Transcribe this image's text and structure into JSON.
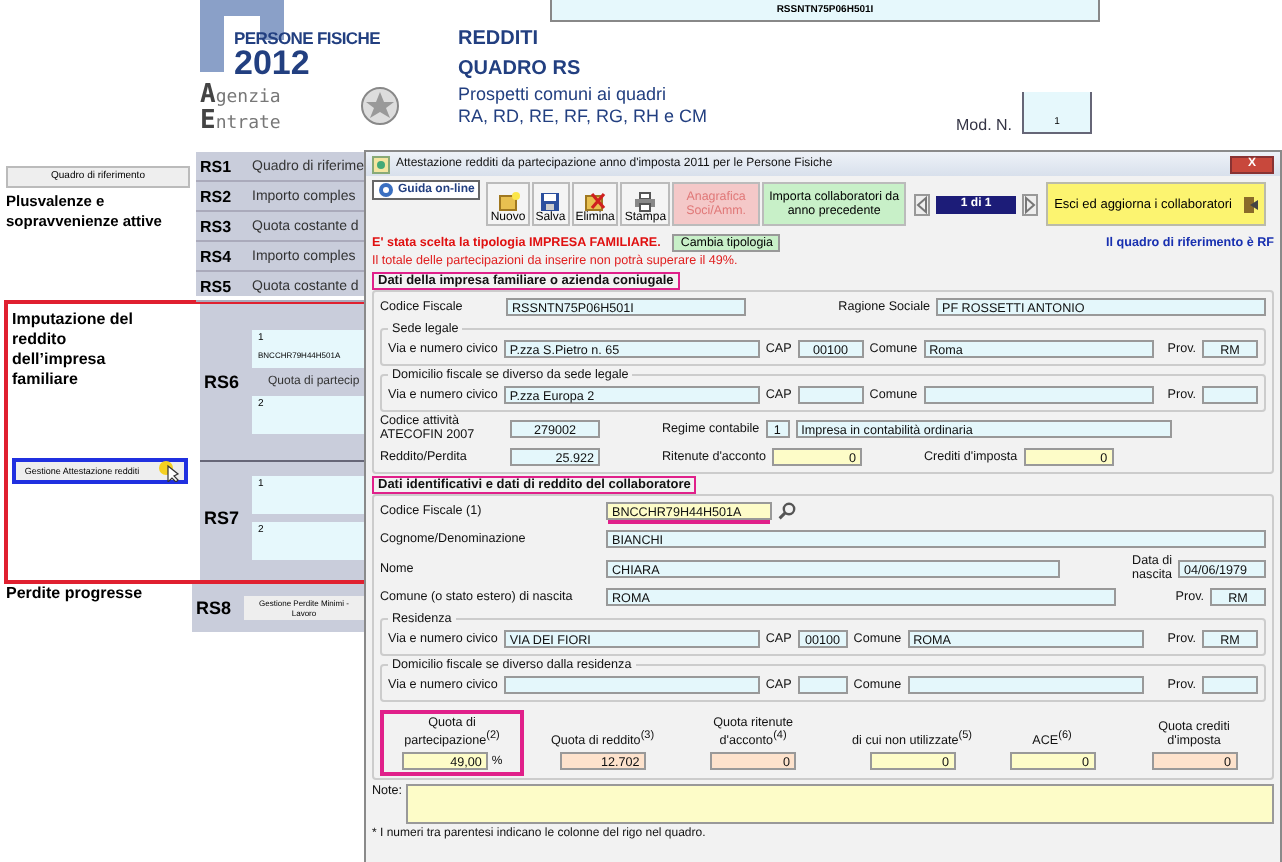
{
  "header": {
    "code_field": "RSSNTN75P06H501I",
    "brand": "PERSONE FISICHE",
    "year": "2012",
    "agency": [
      "Agenzia",
      "Entrate"
    ],
    "titles": [
      "REDDITI",
      "QUADRO RS"
    ],
    "subtitle": [
      "Prospetti comuni ai quadri",
      "RA, RD, RE, RF, RG, RH e CM"
    ],
    "mod_label": "Mod. N.",
    "mod_value": "1"
  },
  "form": {
    "reference_button": "Quadro di riferimento",
    "gains_label": "Plusvalenze e sopravvenienze attive",
    "rows": [
      {
        "code": "RS1",
        "text": "Quadro di riferime"
      },
      {
        "code": "RS2",
        "text": "Importo comples"
      },
      {
        "code": "RS3",
        "text": "Quota costante d"
      },
      {
        "code": "RS4",
        "text": "Importo comples"
      },
      {
        "code": "RS5",
        "text": "Quota costante d"
      }
    ],
    "family": {
      "label": "Imputazione del reddito dell’impresa familiare",
      "button": "Gestione Attestazione redditi",
      "highlighted": true,
      "rows": [
        {
          "code": "RS6",
          "number_1": "1",
          "value_1": "BNCCHR79H44H501A",
          "caption": "Quota di partecip",
          "number_2": "2"
        },
        {
          "code": "RS7",
          "number_1": "1",
          "number_2": "2"
        }
      ]
    },
    "losses": {
      "label": "Perdite progresse",
      "code": "RS8",
      "button": "Gestione Perdite Minimi - Lavoro"
    }
  },
  "dialog": {
    "title": "Attestazione redditi da partecipazione anno d'imposta 2011 per le Persone Fisiche",
    "close": "X",
    "help": "Guida on-line",
    "tools": [
      {
        "kind": "icon",
        "label": "Nuovo",
        "disabled": false
      },
      {
        "kind": "icon",
        "label": "Salva",
        "disabled": false
      },
      {
        "kind": "icon",
        "label": "Elimina",
        "disabled": false
      },
      {
        "kind": "icon",
        "label": "Stampa",
        "disabled": false
      },
      {
        "kind": "text",
        "label": "Anagrafica Soci/Amm.",
        "disabled": true
      },
      {
        "kind": "text",
        "label": "Importa collaboratori da anno precedente",
        "disabled": false
      }
    ],
    "pager": "1 di 1",
    "exit": "Esci ed aggiorna i collaboratori",
    "notice": "E' stata scelta la tipologia IMPRESA FAMILIARE.",
    "change_button": "Cambia tipologia",
    "reference_note": "Il quadro di riferimento è RF",
    "warning": "Il totale delle partecipazioni da inserire non potrà superare il 49%.",
    "company": {
      "title": "Dati della impresa familiare o azienda coniugale",
      "highlighted": true,
      "tax_code": {
        "label": "Codice Fiscale",
        "value": "RSSNTN75P06H501I"
      },
      "name": {
        "label": "Ragione Sociale",
        "value": "PF ROSSETTI ANTONIO"
      },
      "addresses": [
        {
          "title": "Sede legale",
          "street_label": "Via e numero civico",
          "street": "P.zza S.Pietro n. 65",
          "cap_label": "CAP",
          "cap": "00100",
          "city_label": "Comune",
          "city": "Roma",
          "prov_label": "Prov.",
          "prov": "RM"
        },
        {
          "title": "Domicilio fiscale se diverso da sede legale",
          "street_label": "Via e numero civico",
          "street": "P.zza Europa 2",
          "cap_label": "CAP",
          "city_label": "Comune",
          "prov_label": "Prov."
        }
      ],
      "activity": {
        "label": "Codice attività ATECOFIN 2007",
        "value": "279002"
      },
      "regime": {
        "label": "Regime contabile",
        "code": "1",
        "value": "Impresa  in contabilità ordinaria"
      },
      "income": {
        "label": "Reddito/Perdita",
        "value": "25.922"
      },
      "withholding": {
        "label": "Ritenute d'acconto",
        "value": "0"
      },
      "credits": {
        "label": "Crediti d'imposta",
        "value": "0"
      }
    },
    "collaborator": {
      "title": "Dati identificativi e dati di reddito del collaboratore",
      "highlighted": true,
      "tax_code": {
        "label": "Codice Fiscale (1)",
        "value": "BNCCHR79H44H501A",
        "highlighted": true
      },
      "surname": {
        "label": "Cognome/Denominazione",
        "value": "BIANCHI"
      },
      "first_name": {
        "label": "Nome",
        "value": "CHIARA"
      },
      "birth_date": {
        "label": "Data di nascita",
        "value": "04/06/1979"
      },
      "birthplace": {
        "label": "Comune (o stato estero) di nascita",
        "value": "ROMA",
        "prov_label": "Prov.",
        "prov": "RM"
      },
      "addresses": [
        {
          "title": "Residenza",
          "street_label": "Via e numero civico",
          "street": "VIA DEI FIORI",
          "cap_label": "CAP",
          "cap": "00100",
          "city_label": "Comune",
          "city": "ROMA",
          "prov_label": "Prov.",
          "prov": "RM"
        },
        {
          "title": "Domicilio fiscale se diverso dalla residenza",
          "street_label": "Via e numero civico",
          "cap_label": "CAP",
          "city_label": "Comune",
          "prov_label": "Prov."
        }
      ],
      "shares": [
        {
          "label": "Quota di partecipazione",
          "column": "(2)",
          "value": "49,00",
          "unit": "%",
          "kind": "editable",
          "highlighted": true
        },
        {
          "label": "Quota di reddito",
          "column": "(3)",
          "value": "12.702",
          "kind": "computed",
          "highlighted": false
        },
        {
          "label": "Quota ritenute d'acconto",
          "column": "(4)",
          "value": "0",
          "kind": "computed",
          "highlighted": false
        },
        {
          "label": "di cui non utilizzate",
          "column": "(5)",
          "value": "0",
          "kind": "editable",
          "highlighted": false
        },
        {
          "label": "ACE",
          "column": "(6)",
          "value": "0",
          "kind": "editable",
          "highlighted": false
        },
        {
          "label": "Quota crediti d'imposta",
          "value": "0",
          "kind": "computed",
          "highlighted": false
        }
      ]
    },
    "note_label": "Note:",
    "footer": "* I numeri tra parentesi indicano le colonne del rigo nel quadro."
  }
}
